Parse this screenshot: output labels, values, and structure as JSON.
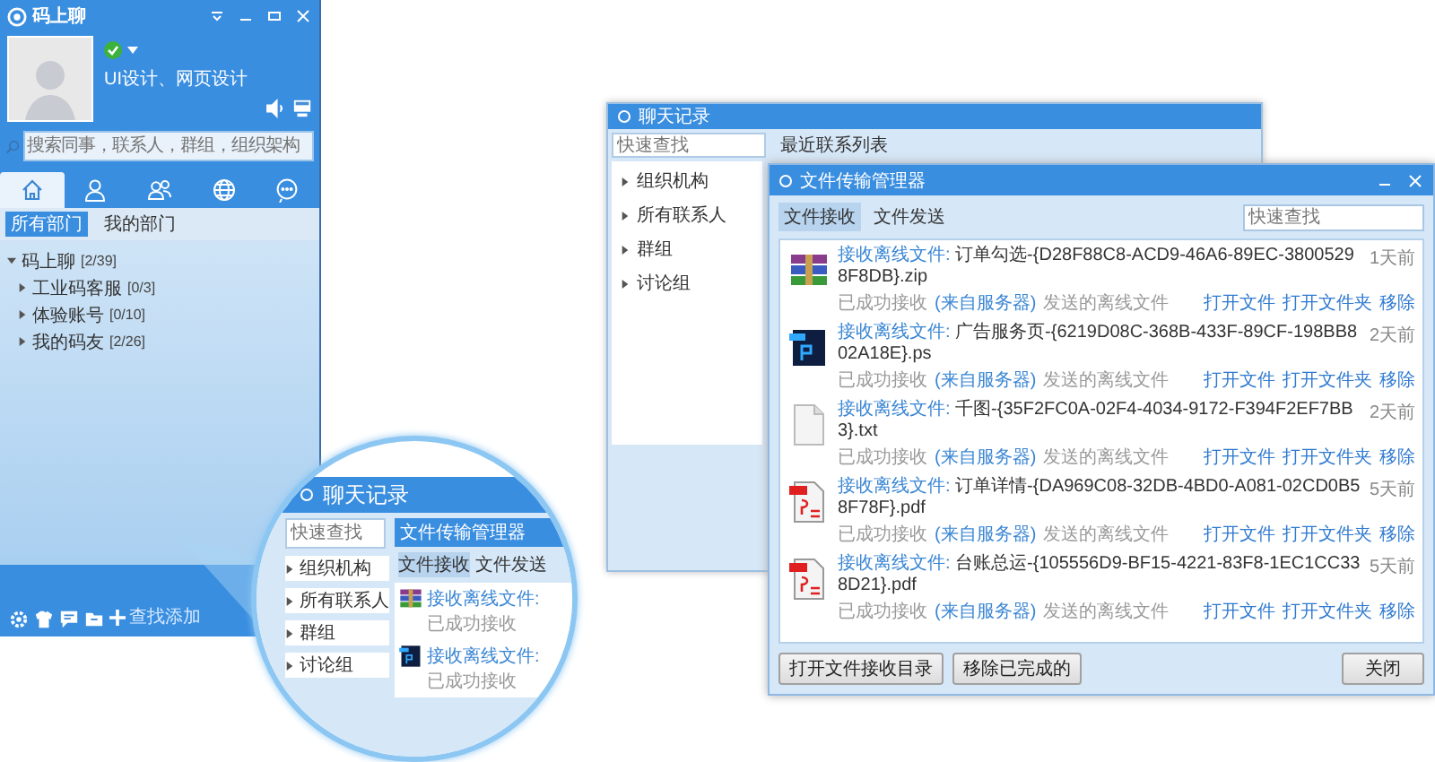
{
  "main_panel": {
    "app_name": "码上聊",
    "signature": "UI设计、网页设计",
    "search": {
      "placeholder": "搜索同事，联系人，群组，组织架构"
    },
    "nav_tabs": [
      {
        "kind": "home",
        "selected": true
      },
      {
        "kind": "contact",
        "selected": false
      },
      {
        "kind": "group",
        "selected": false
      },
      {
        "kind": "globe",
        "selected": false
      },
      {
        "kind": "chat",
        "selected": false
      }
    ],
    "sub_tabs": [
      {
        "label": "所有部门",
        "selected": true
      },
      {
        "label": "我的部门",
        "selected": false
      }
    ],
    "tree": [
      {
        "label": "码上聊",
        "count": "[2/39]",
        "expanded": true,
        "children": [
          {
            "label": "工业码客服",
            "count": "[0/3]",
            "expanded": false
          },
          {
            "label": "体验账号",
            "count": "[0/10]",
            "expanded": false
          },
          {
            "label": "我的码友",
            "count": "[2/26]",
            "expanded": false
          }
        ]
      }
    ],
    "footer": {
      "add_label": "查找添加"
    }
  },
  "chat_window": {
    "title": "聊天记录",
    "search": {
      "placeholder": "快速查找"
    },
    "recent_label": "最近联系列表",
    "tree": [
      {
        "label": "组织机构"
      },
      {
        "label": "所有联系人"
      },
      {
        "label": "群组"
      },
      {
        "label": "讨论组"
      }
    ]
  },
  "file_window": {
    "title": "文件传输管理器",
    "tabs": [
      {
        "label": "文件接收",
        "selected": true
      },
      {
        "label": "文件发送",
        "selected": false
      }
    ],
    "search": {
      "placeholder": "快速查找"
    },
    "files": [
      {
        "kind": "zip",
        "label": "接收离线文件:",
        "name": "订单勾选-{D28F88C8-ACD9-46A6-89EC-38005298F8DB}.zip",
        "time": "1天前",
        "status": "已成功接收",
        "sender": "(来自服务器)",
        "note": "发送的离线文件",
        "actions": [
          "打开文件",
          "打开文件夹",
          "移除"
        ]
      },
      {
        "kind": "ps",
        "label": "接收离线文件:",
        "name": "广告服务页-{6219D08C-368B-433F-89CF-198BB802A18E}.ps",
        "time": "2天前",
        "status": "已成功接收",
        "sender": "(来自服务器)",
        "note": "发送的离线文件",
        "actions": [
          "打开文件",
          "打开文件夹",
          "移除"
        ]
      },
      {
        "kind": "txt",
        "label": "接收离线文件:",
        "name": "千图-{35F2FC0A-02F4-4034-9172-F394F2EF7BB3}.txt",
        "time": "2天前",
        "status": "已成功接收",
        "sender": "(来自服务器)",
        "note": "发送的离线文件",
        "actions": [
          "打开文件",
          "打开文件夹",
          "移除"
        ]
      },
      {
        "kind": "pdf",
        "label": "接收离线文件:",
        "name": "订单详情-{DA969C08-32DB-4BD0-A081-02CD0B58F78F}.pdf",
        "time": "5天前",
        "status": "已成功接收",
        "sender": "(来自服务器)",
        "note": "发送的离线文件",
        "actions": [
          "打开文件",
          "打开文件夹",
          "移除"
        ]
      },
      {
        "kind": "pdf",
        "label": "接收离线文件:",
        "name": "台账总运-{105556D9-BF15-4221-83F8-1EC1CC338D21}.pdf",
        "time": "5天前",
        "status": "已成功接收",
        "sender": "(来自服务器)",
        "note": "发送的离线文件",
        "actions": [
          "打开文件",
          "打开文件夹",
          "移除"
        ]
      }
    ],
    "buttons": [
      "打开文件接收目录",
      "移除已完成的"
    ],
    "close_button": "关闭"
  },
  "magnifier": {
    "chat_title": "聊天记录",
    "search": {
      "placeholder": "快速查找"
    },
    "tree": [
      {
        "label": "组织机构"
      },
      {
        "label": "所有联系人"
      },
      {
        "label": "群组"
      },
      {
        "label": "讨论组"
      }
    ],
    "file_title": "文件传输管理器",
    "tabs": [
      {
        "label": "文件接收",
        "selected": true
      },
      {
        "label": "文件发送",
        "selected": false
      }
    ],
    "files": [
      {
        "kind": "zip",
        "label": "接收离线文件:",
        "status": "已成功接收"
      },
      {
        "kind": "ps",
        "label": "接收离线文件:",
        "status": "已成功接收"
      }
    ]
  }
}
